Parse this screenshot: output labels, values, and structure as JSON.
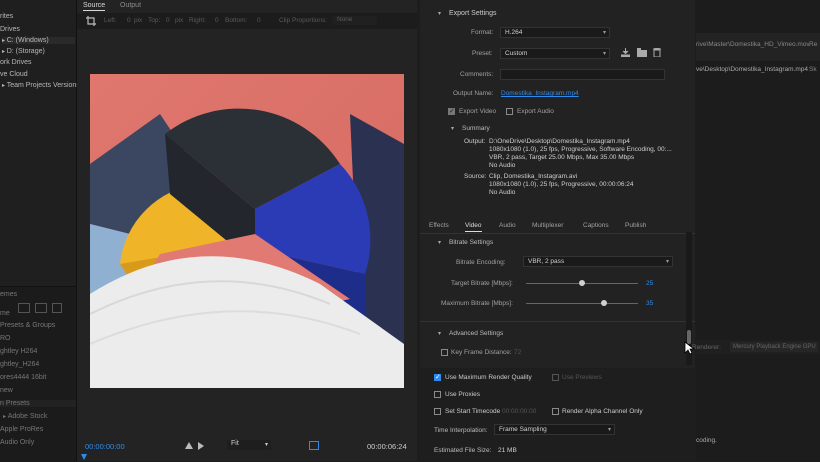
{
  "left": {
    "items": [
      "rites",
      "Drives",
      "C: (Windows)",
      "D: (Storage)",
      "ork Drives",
      "ve Cloud",
      "Team Projects Versions"
    ],
    "bottom": [
      "emes",
      "me",
      "Presets & Groups",
      "RO",
      "ghtley H264",
      "ghtley_H264",
      "ores4444 16bit",
      "new",
      "n Presets",
      "Adobe Stock",
      "Apple ProRes",
      "Audio Only"
    ]
  },
  "source": {
    "tabs": [
      "Source",
      "Output"
    ],
    "crop": {
      "left": "Left:",
      "left_v": "0",
      "left_u": "pix",
      "top": "Top:",
      "top_v": "0",
      "top_u": "pix",
      "right": "Right:",
      "right_v": "0",
      "bottom": "Bottom:",
      "bottom_v": "0",
      "clip_prop": "Clip Proportions:",
      "clip_prop_v": "None"
    },
    "timecode_start": "00:00:00:00",
    "timecode_end": "00:00:06:24",
    "fit": "Fit"
  },
  "export": {
    "section": "Export Settings",
    "format_label": "Format:",
    "format": "H.264",
    "preset_label": "Preset:",
    "preset": "Custom",
    "comments_label": "Comments:",
    "output_label": "Output Name:",
    "output_name": "Domestika_Instagram.mp4",
    "export_video": "Export Video",
    "export_audio": "Export Audio",
    "summary": "Summary",
    "output_head": "Output:",
    "output_lines": [
      "D:\\OneDrive\\Desktop\\Domestika_Instagram.mp4",
      "1080x1080 (1.0), 25 fps, Progressive, Software Encoding, 00:...",
      "VBR, 2 pass, Target 25.00 Mbps, Max 35.00 Mbps",
      "No Audio"
    ],
    "source_head": "Source:",
    "source_lines": [
      "Clip, Domestika_Instagram.avi",
      "1080x1080 (1.0), 25 fps, Progressive, 00:00:06:24",
      "No Audio"
    ],
    "tabs": [
      "Effects",
      "Video",
      "Audio",
      "Multiplexer",
      "Captions",
      "Publish"
    ],
    "bitrate_section": "Bitrate Settings",
    "bitrate_encoding_label": "Bitrate Encoding:",
    "bitrate_encoding": "VBR, 2 pass",
    "target_label": "Target Bitrate [Mbps]:",
    "target_value": "25",
    "max_label": "Maximum Bitrate [Mbps]:",
    "max_value": "35",
    "advanced_section": "Advanced Settings",
    "keyframe_label": "Key Frame Distance:",
    "keyframe_value": "72"
  },
  "export_bottom": {
    "max_render": "Use Maximum Render Quality",
    "use_previews": "Use Previews",
    "use_proxies": "Use Proxies",
    "set_start": "Set Start Timecode",
    "start_tc": "00:00:00:00",
    "render_alpha": "Render Alpha Channel Only",
    "interp_label": "Time Interpolation:",
    "interp_value": "Frame Sampling",
    "filesize_label": "Estimated File Size:",
    "filesize_value": "21 MB"
  },
  "far": {
    "path1": "rive\\Master\\Domestika_HD_Vimeo.mov",
    "path2": "ve\\Desktop\\Domestika_Instagram.mp4",
    "col1": "Re",
    "col2": "Sk",
    "renderer_label": "Renderer:",
    "renderer": "Mercury Playback Engine GPU",
    "encoding": "coding."
  },
  "colors": {
    "accent": "#2d8ceb",
    "coral": "#e0776e",
    "navy": "#2f3a4a",
    "cobalt": "#2a3bb5",
    "yellow": "#f0b429"
  }
}
